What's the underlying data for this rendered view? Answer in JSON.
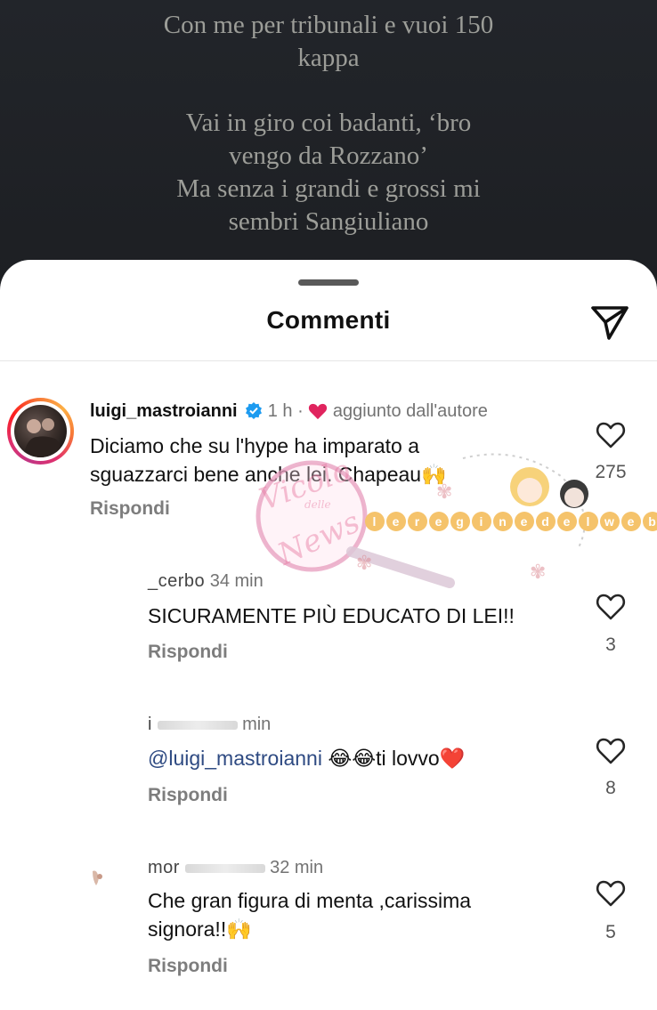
{
  "story": {
    "lyrics": [
      "Con me per tribunali e vuoi 150",
      "kappa",
      "Vai in giro coi badanti, ‘bro",
      "vengo da Rozzano’",
      "Ma senza i grandi e grossi mi",
      "sembri Sangiuliano"
    ]
  },
  "sheet": {
    "title": "Commenti",
    "share_icon": "send-icon"
  },
  "comments": [
    {
      "username": "luigi_mastroianni",
      "verified": true,
      "time": "1 h",
      "separator": "·",
      "badge": "aggiunto dall'autore",
      "text_line1": "Diciamo che su l'hype ha imparato a",
      "text_line2": "sguazzarci bene anche lei. Chapeau",
      "text_emoji": "🙌",
      "likes": "275",
      "reply_label": "Rispondi"
    },
    {
      "username": "_cerbo",
      "time": "34 min",
      "text": "SICURAMENTE PIÙ EDUCATO DI LEI!!",
      "likes": "3",
      "reply_label": "Rispondi"
    },
    {
      "username": "i",
      "time": "min",
      "mention": "@luigi_mastroianni",
      "text_emoji": "😂😂",
      "text": "ti lovvo",
      "text_heart": "❤️",
      "likes": "8",
      "reply_label": "Rispondi"
    },
    {
      "username": "mor",
      "time": "32 min",
      "text_line1": "Che gran figura di menta ,carissima",
      "text_line2": "signora!!",
      "text_emoji": "🙌",
      "likes": "5",
      "reply_label": "Rispondi"
    }
  ],
  "watermark": {
    "line1": "Vicolo",
    "line2": "delle",
    "line3": "News",
    "chain": "le regine del web"
  },
  "colors": {
    "story_bg": "#1c1e22",
    "lyrics": "#9c9d98",
    "verified": "#1d9bf0",
    "heart_badge": "#e0245e",
    "mention": "#2e4a82"
  }
}
